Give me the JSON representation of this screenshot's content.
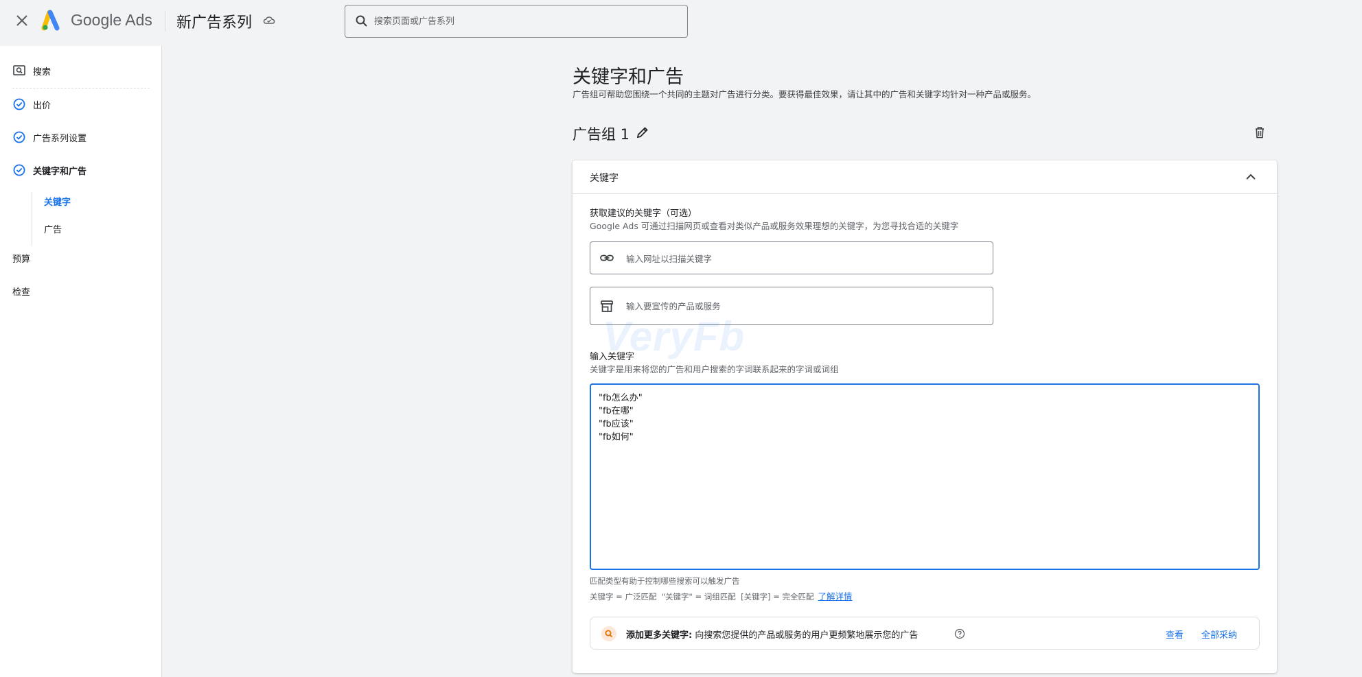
{
  "header": {
    "brand": "Google Ads",
    "campaign_title": "新广告系列",
    "search_placeholder": "搜索页面或广告系列"
  },
  "sidebar": {
    "items": [
      {
        "label": "搜索",
        "icon": "search-box-icon"
      },
      {
        "label": "出价",
        "icon": "check-circle-icon"
      },
      {
        "label": "广告系列设置",
        "icon": "check-circle-icon"
      },
      {
        "label": "关键字和广告",
        "icon": "check-circle-icon"
      },
      {
        "label": "预算"
      },
      {
        "label": "检查"
      }
    ],
    "sub_items": [
      {
        "label": "关键字",
        "active": true
      },
      {
        "label": "广告",
        "active": false
      }
    ]
  },
  "main": {
    "title": "关键字和广告",
    "description": "广告组可帮助您围绕一个共同的主题对广告进行分类。要获得最佳效果，请让其中的广告和关键字均针对一种产品或服务。",
    "group_title": "广告组 1"
  },
  "card": {
    "header_label": "关键字",
    "suggest_title": "获取建议的关键字（可选）",
    "suggest_desc": "Google Ads 可通过扫描网页或查看对类似产品或服务效果理想的关键字，为您寻找合适的关键字",
    "url_placeholder": "输入网址以扫描关键字",
    "product_placeholder": "输入要宣传的产品或服务",
    "watermark": "VeryFb",
    "keywords_title": "输入关键字",
    "keywords_desc": "关键字是用来将您的广告和用户搜索的字词联系起来的字词或词组",
    "keywords": [
      "\"fb怎么办\"",
      "\"fb在哪\"",
      "\"fb应该\"",
      "\"fb如何\""
    ],
    "match_hint": "匹配类型有助于控制哪些搜索可以触发广告",
    "match_types": "关键字 = 广泛匹配  \"关键字\" = 词组匹配  [关键字] = 完全匹配",
    "learn_more": "了解详情",
    "more_bold": "添加更多关键字:",
    "more_text": " 向搜索您提供的产品或服务的用户更频繁地展示您的广告",
    "view_label": "查看",
    "adopt_all_label": "全部采纳"
  },
  "colors": {
    "accent": "#1a73e8",
    "background": "#f1f3f4",
    "text": "#202124",
    "secondary_text": "#5f6368"
  }
}
